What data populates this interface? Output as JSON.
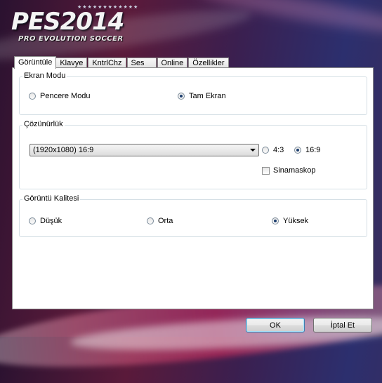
{
  "logo": {
    "stars": "★★★★★★★★★★★★",
    "title": "PES2014",
    "subtitle": "PRO EVOLUTION SOCCER"
  },
  "tabs": [
    {
      "label": "Görüntüle",
      "active": true
    },
    {
      "label": "Klavye",
      "active": false
    },
    {
      "label": "KntrlChz",
      "active": false
    },
    {
      "label": "Ses",
      "active": false
    },
    {
      "label": "Online",
      "active": false
    },
    {
      "label": "Özellikler",
      "active": false
    }
  ],
  "screen_mode": {
    "title": "Ekran Modu",
    "options": [
      {
        "label": "Pencere Modu",
        "selected": false
      },
      {
        "label": "Tam Ekran",
        "selected": true
      }
    ]
  },
  "resolution": {
    "title": "Çözünürlük",
    "selected_value": "(1920x1080) 16:9",
    "aspect_options": [
      {
        "label": "4:3",
        "selected": false
      },
      {
        "label": "16:9",
        "selected": true
      }
    ],
    "cinemascope": {
      "label": "Sinamaskop",
      "checked": false
    }
  },
  "quality": {
    "title": "Görüntü Kalitesi",
    "options": [
      {
        "label": "Düşük",
        "selected": false
      },
      {
        "label": "Orta",
        "selected": false
      },
      {
        "label": "Yüksek",
        "selected": true
      }
    ]
  },
  "buttons": {
    "ok": "OK",
    "cancel": "İptal Et"
  }
}
